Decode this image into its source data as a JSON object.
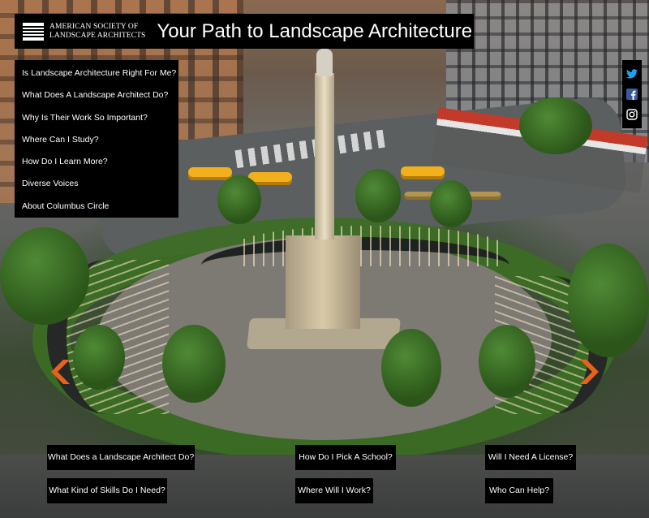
{
  "header": {
    "logo_line1": "AMERICAN SOCIETY OF",
    "logo_line2": "LANDSCAPE ARCHITECTS",
    "title": "Your Path to Landscape Architecture"
  },
  "nav": {
    "items": [
      {
        "label": "Is Landscape Architecture Right For Me?"
      },
      {
        "label": "What Does A Landscape Architect Do?"
      },
      {
        "label": "Why Is Their Work So Important?"
      },
      {
        "label": "Where Can I Study?"
      },
      {
        "label": "How Do I Learn More?"
      },
      {
        "label": "Diverse Voices"
      },
      {
        "label": "About Columbus Circle"
      }
    ]
  },
  "social": {
    "items": [
      {
        "icon": "twitter-icon",
        "color": "#1da1f2"
      },
      {
        "icon": "facebook-icon",
        "color": "#3b5998"
      },
      {
        "icon": "instagram-icon",
        "color": "#ffffff"
      }
    ]
  },
  "arrows": {
    "color": "#e8621c",
    "left_icon": "chevron-left-icon",
    "right_icon": "chevron-right-icon"
  },
  "questions": {
    "q1": "What Does a Landscape Architect Do?",
    "q2": "What Kind of Skills Do I Need?",
    "q3": "How Do I Pick A School?",
    "q4": "Where Will I Work?",
    "q5": "Will I Need A License?",
    "q6": "Who Can Help?"
  }
}
